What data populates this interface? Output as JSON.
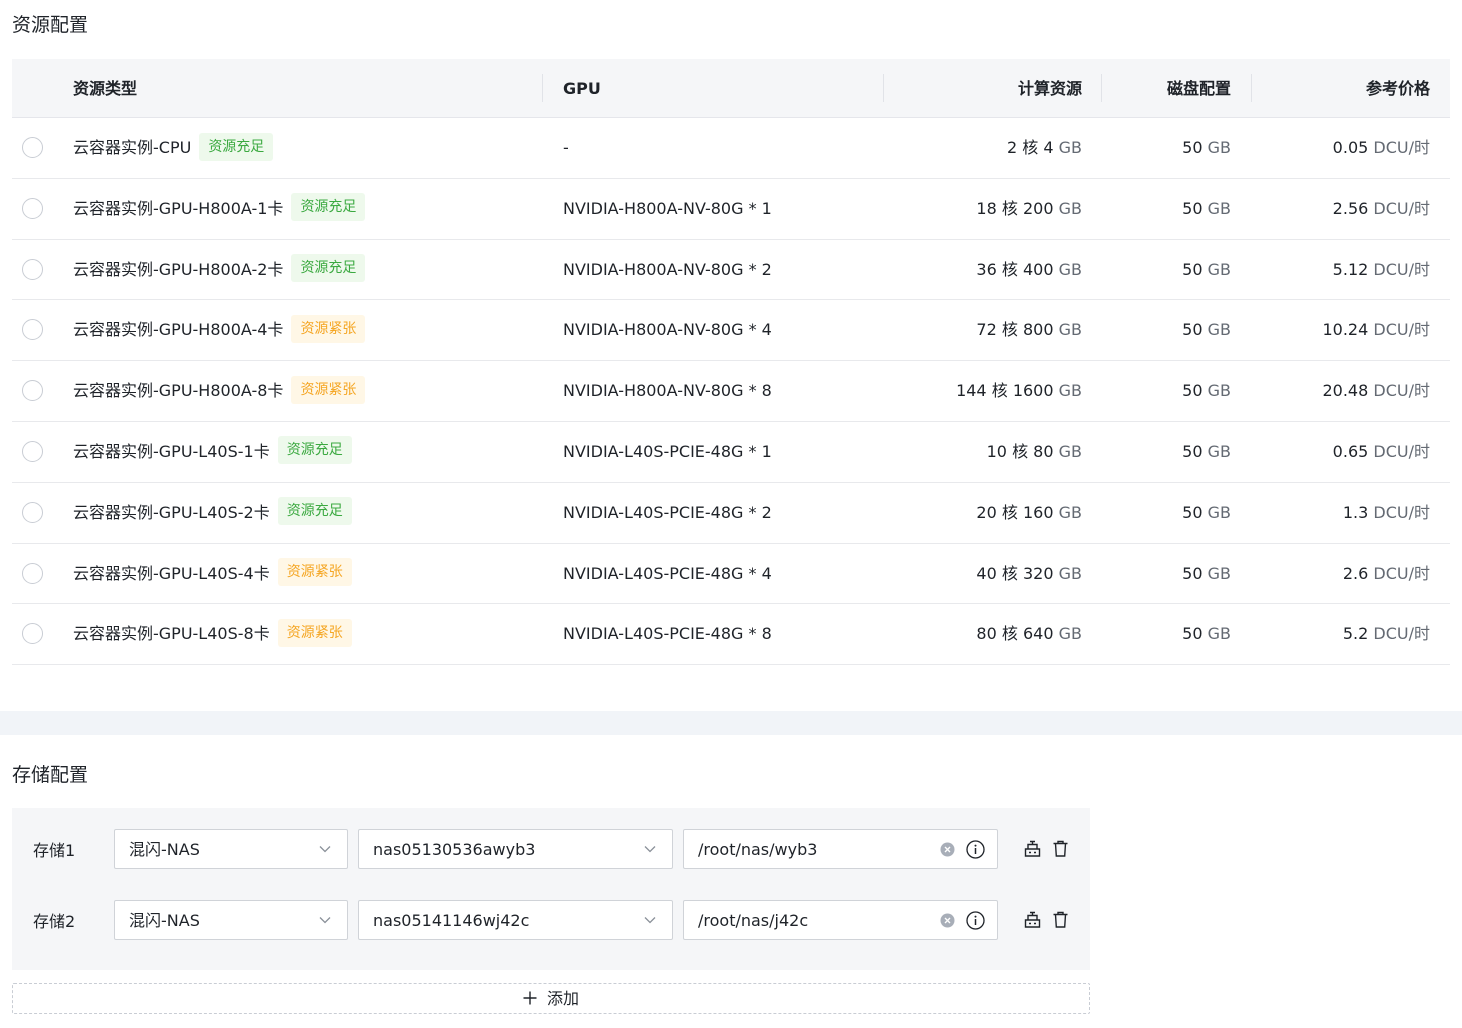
{
  "resource_section": {
    "title": "资源配置",
    "headers": {
      "type": "资源类型",
      "gpu": "GPU",
      "compute": "计算资源",
      "disk": "磁盘配置",
      "price": "参考价格"
    },
    "rows": [
      {
        "name": "云容器实例-CPU",
        "tag": "资源充足",
        "tag_status": "ok",
        "gpu": "-",
        "cores": "2",
        "core_unit": "核",
        "mem": "4",
        "mem_unit": "GB",
        "disk": "50",
        "disk_unit": "GB",
        "price": "0.05",
        "price_unit": "DCU/时"
      },
      {
        "name": "云容器实例-GPU-H800A-1卡",
        "tag": "资源充足",
        "tag_status": "ok",
        "gpu": "NVIDIA-H800A-NV-80G * 1",
        "cores": "18",
        "core_unit": "核",
        "mem": "200",
        "mem_unit": "GB",
        "disk": "50",
        "disk_unit": "GB",
        "price": "2.56",
        "price_unit": "DCU/时"
      },
      {
        "name": "云容器实例-GPU-H800A-2卡",
        "tag": "资源充足",
        "tag_status": "ok",
        "gpu": "NVIDIA-H800A-NV-80G * 2",
        "cores": "36",
        "core_unit": "核",
        "mem": "400",
        "mem_unit": "GB",
        "disk": "50",
        "disk_unit": "GB",
        "price": "5.12",
        "price_unit": "DCU/时"
      },
      {
        "name": "云容器实例-GPU-H800A-4卡",
        "tag": "资源紧张",
        "tag_status": "tight",
        "gpu": "NVIDIA-H800A-NV-80G * 4",
        "cores": "72",
        "core_unit": "核",
        "mem": "800",
        "mem_unit": "GB",
        "disk": "50",
        "disk_unit": "GB",
        "price": "10.24",
        "price_unit": "DCU/时"
      },
      {
        "name": "云容器实例-GPU-H800A-8卡",
        "tag": "资源紧张",
        "tag_status": "tight",
        "gpu": "NVIDIA-H800A-NV-80G * 8",
        "cores": "144",
        "core_unit": "核",
        "mem": "1600",
        "mem_unit": "GB",
        "disk": "50",
        "disk_unit": "GB",
        "price": "20.48",
        "price_unit": "DCU/时"
      },
      {
        "name": "云容器实例-GPU-L40S-1卡",
        "tag": "资源充足",
        "tag_status": "ok",
        "gpu": "NVIDIA-L40S-PCIE-48G * 1",
        "cores": "10",
        "core_unit": "核",
        "mem": "80",
        "mem_unit": "GB",
        "disk": "50",
        "disk_unit": "GB",
        "price": "0.65",
        "price_unit": "DCU/时"
      },
      {
        "name": "云容器实例-GPU-L40S-2卡",
        "tag": "资源充足",
        "tag_status": "ok",
        "gpu": "NVIDIA-L40S-PCIE-48G * 2",
        "cores": "20",
        "core_unit": "核",
        "mem": "160",
        "mem_unit": "GB",
        "disk": "50",
        "disk_unit": "GB",
        "price": "1.3",
        "price_unit": "DCU/时"
      },
      {
        "name": "云容器实例-GPU-L40S-4卡",
        "tag": "资源紧张",
        "tag_status": "tight",
        "gpu": "NVIDIA-L40S-PCIE-48G * 4",
        "cores": "40",
        "core_unit": "核",
        "mem": "320",
        "mem_unit": "GB",
        "disk": "50",
        "disk_unit": "GB",
        "price": "2.6",
        "price_unit": "DCU/时"
      },
      {
        "name": "云容器实例-GPU-L40S-8卡",
        "tag": "资源紧张",
        "tag_status": "tight",
        "gpu": "NVIDIA-L40S-PCIE-48G * 8",
        "cores": "80",
        "core_unit": "核",
        "mem": "640",
        "mem_unit": "GB",
        "disk": "50",
        "disk_unit": "GB",
        "price": "5.2",
        "price_unit": "DCU/时"
      }
    ]
  },
  "storage_section": {
    "title": "存储配置",
    "rows": [
      {
        "label": "存储1",
        "type": "混闪-NAS",
        "nas": "nas05130536awyb3",
        "path": "/root/nas/wyb3"
      },
      {
        "label": "存储2",
        "type": "混闪-NAS",
        "nas": "nas05141146wj42c",
        "path": "/root/nas/j42c"
      }
    ],
    "add_label": "添加"
  },
  "colors": {
    "tag_ok_text": "#3ba940",
    "tag_ok_bg": "#eef9ec",
    "tag_tight_text": "#f5a623",
    "tag_tight_bg": "#fff7e6",
    "header_bg": "#f5f6f8"
  },
  "icons": [
    "radio-button",
    "chevron-down-icon",
    "clear-icon",
    "info-icon",
    "mount-icon",
    "trash-icon",
    "plus-icon"
  ]
}
